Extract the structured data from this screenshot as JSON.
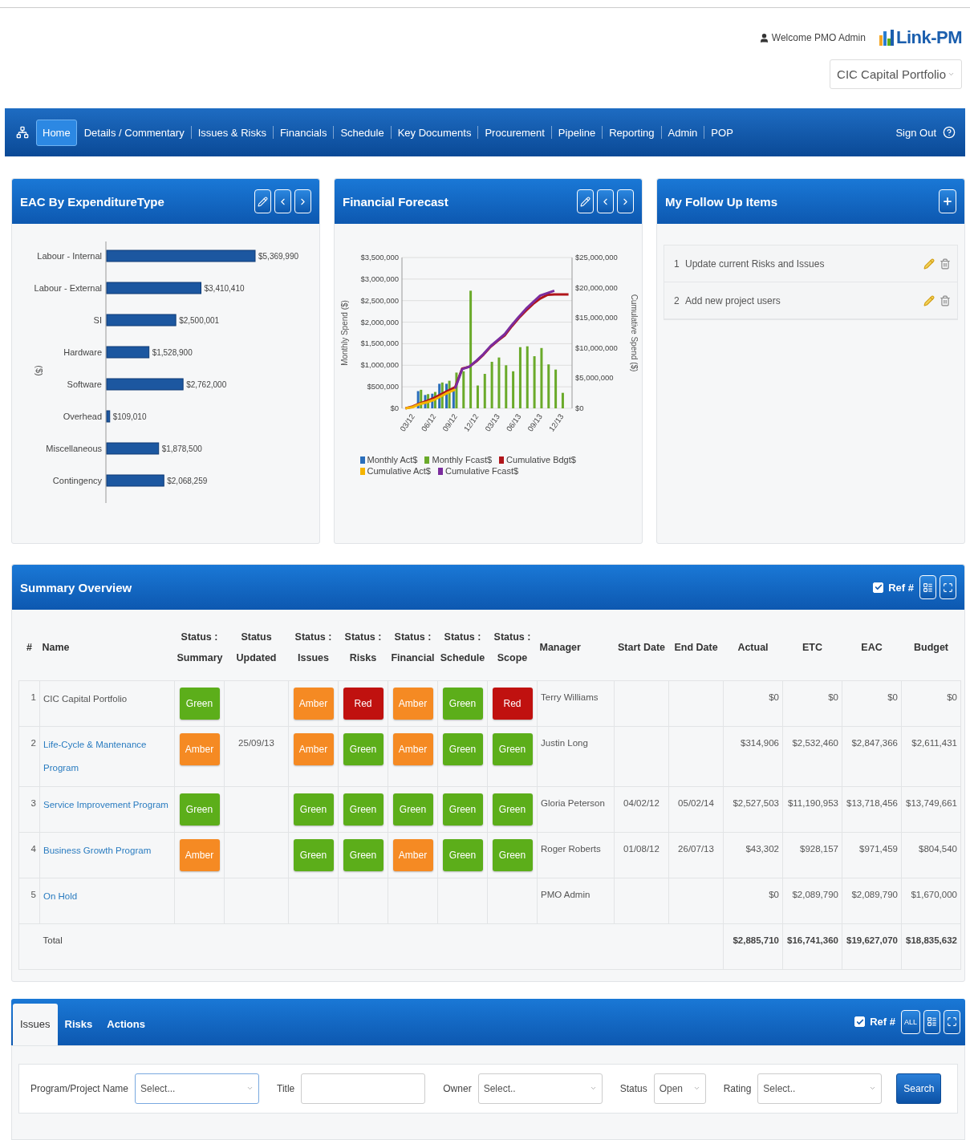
{
  "header": {
    "welcome": "Welcome PMO Admin",
    "logo": "Link-PM",
    "portfolio": "CIC Capital Portfolio"
  },
  "nav": {
    "items": [
      {
        "label": "Home",
        "selected": true
      },
      {
        "label": "Details / Commentary",
        "selected": false
      },
      {
        "label": "Issues & Risks",
        "selected": false
      },
      {
        "label": "Financials",
        "selected": false
      },
      {
        "label": "Schedule",
        "selected": false
      },
      {
        "label": "Key Documents",
        "selected": false
      },
      {
        "label": "Procurement",
        "selected": false
      },
      {
        "label": "Pipeline",
        "selected": false
      },
      {
        "label": "Reporting",
        "selected": false
      },
      {
        "label": "Admin",
        "selected": false
      },
      {
        "label": "POP",
        "selected": false
      }
    ],
    "sign_out": "Sign Out"
  },
  "eac_panel": {
    "title": "EAC By ExpenditureType",
    "chart_data": {
      "type": "bar",
      "orientation": "horizontal",
      "ylabel": "($)",
      "categories": [
        "Labour - Internal",
        "Labour - External",
        "SI",
        "Hardware",
        "Software",
        "Overhead",
        "Miscellaneous",
        "Contingency"
      ],
      "values": [
        5369990,
        3410410,
        2500001,
        1528900,
        2762000,
        109010,
        1878500,
        2068259
      ],
      "data_labels": true,
      "value_labels": [
        "$5,369,990",
        "$3,410,410",
        "$2,500,001",
        "$1,528,900",
        "$2,762,000",
        "$109,010",
        "$1,878,500",
        "$2,068,259"
      ]
    }
  },
  "forecast_panel": {
    "title": "Financial Forecast",
    "chart_data": {
      "type": "bar",
      "ylabel": "Monthly Spend ($)",
      "y2label": "Cumulative Spend ($)",
      "categories": [
        null,
        "03/12",
        null,
        null,
        "06/12",
        null,
        null,
        "09/12",
        null,
        null,
        "12/12",
        null,
        null,
        "03/13",
        null,
        null,
        "06/13",
        null,
        null,
        "09/13",
        null,
        null,
        "12/13",
        null
      ],
      "ylim": [
        0,
        3500000
      ],
      "y2lim": [
        0,
        25000000
      ],
      "grid": true,
      "legend": "bottom",
      "yticks": [
        {
          "value": 0,
          "label": "$0"
        },
        {
          "value": 500000,
          "label": "$500,000"
        },
        {
          "value": 1000000,
          "label": "$1,000,000"
        },
        {
          "value": 1500000,
          "label": "$1,500,000"
        },
        {
          "value": 2000000,
          "label": "$2,000,000"
        },
        {
          "value": 2500000,
          "label": "$2,500,000"
        },
        {
          "value": 3000000,
          "label": "$3,000,000"
        },
        {
          "value": 3500000,
          "label": "$3,500,000"
        }
      ],
      "y2ticks": [
        {
          "value": 0,
          "label": "$0"
        },
        {
          "value": 5000000,
          "label": "$5,000,000"
        },
        {
          "value": 10000000,
          "label": "$10,000,000"
        },
        {
          "value": 15000000,
          "label": "$15,000,000"
        },
        {
          "value": 20000000,
          "label": "$20,000,000"
        },
        {
          "value": 25000000,
          "label": "$25,000,000"
        }
      ],
      "series": [
        {
          "name": "Monthly Act$",
          "color": "#2a6ebb",
          "type": "bar",
          "values": [
            null,
            null,
            400000,
            310000,
            340000,
            570000,
            570000,
            460000,
            null,
            null,
            null,
            null,
            null,
            null,
            null,
            null,
            null,
            null,
            null,
            null,
            null,
            null,
            null,
            null
          ]
        },
        {
          "name": "Monthly Fcast$",
          "color": "#6aaa2a",
          "type": "bar",
          "values": [
            0,
            0,
            430000,
            330000,
            380000,
            600000,
            640000,
            830000,
            860000,
            2730000,
            530000,
            800000,
            1080000,
            1180000,
            1000000,
            860000,
            1420000,
            1440000,
            1210000,
            1400000,
            1020000,
            900000,
            360000,
            0
          ]
        },
        {
          "name": "Cumulative Bdgt$",
          "color": "#b0151a",
          "type": "line",
          "axis": "y2",
          "values": [
            0,
            300000,
            800000,
            1200000,
            1700000,
            2300000,
            2900000,
            3500000,
            6600000,
            6900000,
            7800000,
            8900000,
            10200000,
            11200000,
            12100000,
            13600000,
            15000000,
            16200000,
            17300000,
            18200000,
            18800000,
            18900000,
            18900000,
            18900000
          ]
        },
        {
          "name": "Cumulative Act$",
          "color": "#f5b400",
          "type": "line",
          "axis": "y2",
          "values": [
            0,
            200000,
            700000,
            1000000,
            1400000,
            2000000,
            2600000,
            3100000,
            null,
            null,
            null,
            null,
            null,
            null,
            null,
            null,
            null,
            null,
            null,
            null,
            null,
            null,
            null,
            null
          ]
        },
        {
          "name": "Cumulative Fcast$",
          "color": "#7b2c9e",
          "type": "line",
          "axis": "y2",
          "values": [
            null,
            null,
            null,
            null,
            null,
            null,
            null,
            3300000,
            6500000,
            6900000,
            7900000,
            9000000,
            10300000,
            11300000,
            12300000,
            13800000,
            15200000,
            16500000,
            17600000,
            18700000,
            19100000,
            19500000,
            null,
            null
          ]
        }
      ]
    }
  },
  "follow_panel": {
    "title": "My Follow Up Items",
    "items": [
      {
        "number": "1",
        "text": "Update current Risks and Issues"
      },
      {
        "number": "2",
        "text": "Add new project users"
      }
    ]
  },
  "summary": {
    "title": "Summary Overview",
    "ref_label": "Ref #",
    "ref_checked": true,
    "columns": [
      "#",
      "Name",
      "Status : Summary",
      "Status Updated",
      "Status : Issues",
      "Status : Risks",
      "Status : Financial",
      "Status : Schedule",
      "Status : Scope",
      "Manager",
      "Start Date",
      "End Date",
      "Actual",
      "ETC",
      "EAC",
      "Budget"
    ],
    "rows": [
      {
        "number": "1",
        "name": "CIC Capital Portfolio",
        "link": false,
        "summary": {
          "label": "Green",
          "color": "#5cae1a"
        },
        "statuses": [
          {
            "label": "Amber",
            "color": "#f58a23"
          },
          {
            "label": "Red",
            "color": "#c0110f"
          },
          {
            "label": "Amber",
            "color": "#f58a23"
          },
          {
            "label": "Green",
            "color": "#5cae1a"
          },
          {
            "label": "Red",
            "color": "#c0110f"
          }
        ],
        "manager": "Terry Williams",
        "actual": "$0",
        "etc": "$0",
        "eac": "$0",
        "budget": "$0"
      },
      {
        "number": "2",
        "name": "Life-Cycle & Mantenance Program",
        "link": true,
        "summary": {
          "label": "Amber",
          "color": "#f58a23"
        },
        "updated": "25/09/13",
        "statuses": [
          {
            "label": "Amber",
            "color": "#f58a23"
          },
          {
            "label": "Green",
            "color": "#5cae1a"
          },
          {
            "label": "Amber",
            "color": "#f58a23"
          },
          {
            "label": "Green",
            "color": "#5cae1a"
          },
          {
            "label": "Green",
            "color": "#5cae1a"
          }
        ],
        "manager": "Justin Long",
        "actual": "$314,906",
        "etc": "$2,532,460",
        "eac": "$2,847,366",
        "budget": "$2,611,431"
      },
      {
        "number": "3",
        "name": "Service Improvement Program",
        "link": true,
        "summary": {
          "label": "Green",
          "color": "#5cae1a"
        },
        "statuses": [
          {
            "label": "Green",
            "color": "#5cae1a"
          },
          {
            "label": "Green",
            "color": "#5cae1a"
          },
          {
            "label": "Green",
            "color": "#5cae1a"
          },
          {
            "label": "Green",
            "color": "#5cae1a"
          },
          {
            "label": "Green",
            "color": "#5cae1a"
          }
        ],
        "manager": "Gloria Peterson",
        "start": "04/02/12",
        "end": "05/02/14",
        "actual": "$2,527,503",
        "etc": "$11,190,953",
        "eac": "$13,718,456",
        "budget": "$13,749,661"
      },
      {
        "number": "4",
        "name": "Business Growth Program",
        "link": true,
        "summary": {
          "label": "Amber",
          "color": "#f58a23"
        },
        "statuses": [
          {
            "label": "Green",
            "color": "#5cae1a"
          },
          {
            "label": "Green",
            "color": "#5cae1a"
          },
          {
            "label": "Amber",
            "color": "#f58a23"
          },
          {
            "label": "Green",
            "color": "#5cae1a"
          },
          {
            "label": "Green",
            "color": "#5cae1a"
          }
        ],
        "manager": "Roger Roberts",
        "start": "01/08/12",
        "end": "26/07/13",
        "actual": "$43,302",
        "etc": "$928,157",
        "eac": "$971,459",
        "budget": "$804,540"
      },
      {
        "number": "5",
        "name": "On Hold",
        "link": true,
        "manager": "PMO Admin",
        "actual": "$0",
        "etc": "$2,089,790",
        "eac": "$2,089,790",
        "budget": "$1,670,000"
      }
    ],
    "total": {
      "label": "Total",
      "actual": "$2,885,710",
      "etc": "$16,741,360",
      "eac": "$19,627,070",
      "budget": "$18,835,632"
    }
  },
  "bottom": {
    "tabs": [
      {
        "label": "Issues",
        "selected": true
      },
      {
        "label": "Risks",
        "selected": false
      },
      {
        "label": "Actions",
        "selected": false
      }
    ],
    "ref_label": "Ref #",
    "ref_checked": true,
    "all_label": "ALL",
    "filters": [
      {
        "kind": "select",
        "label": "Program/Project Name",
        "value": "Select..."
      },
      {
        "kind": "text",
        "label": "Title"
      },
      {
        "kind": "select",
        "label": "Owner",
        "value": "Select.."
      },
      {
        "kind": "select",
        "label": "Status",
        "value": "Open"
      },
      {
        "kind": "select",
        "label": "Rating",
        "value": "Select.."
      }
    ],
    "search": "Search"
  }
}
